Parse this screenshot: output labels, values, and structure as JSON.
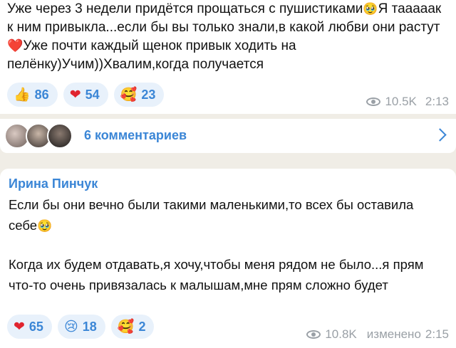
{
  "post": {
    "text_1": "Уже через 3 недели придётся прощаться с пушистиками",
    "emoji_1": "🥹",
    "text_2": "Я тааааак к ним привыкла...если бы вы только знали,в какой любви они растут",
    "emoji_2": "❤️",
    "text_3": "Уже почти каждый щенок привык ходить на пелёнку)Учим))Хвалим,когда получается",
    "reactions": [
      {
        "icon": "👍",
        "count": "86"
      },
      {
        "icon": "❤",
        "count": "54"
      },
      {
        "icon": "🥰",
        "count": "23"
      }
    ],
    "views": "10.5K",
    "time": "2:13"
  },
  "comments_bar": {
    "label": "6 комментариев"
  },
  "reply": {
    "author": "Ирина Пинчук",
    "text_1": "Если бы они вечно были такими маленькими,то всех бы оставила себе",
    "emoji_1": "🥹",
    "text_2": "Когда их будем отдавать,я хочу,чтобы меня рядом не было...я прям что-то очень привязалась к малышам,мне прям сложно будет",
    "reactions": [
      {
        "icon": "❤",
        "count": "65"
      },
      {
        "icon": "😢",
        "count": "18"
      },
      {
        "icon": "🥰",
        "count": "2"
      }
    ],
    "views": "10.8K",
    "edited": "изменено",
    "time": "2:15"
  },
  "colors": {
    "background": "#f0ede6",
    "bubble": "#ffffff",
    "accent": "#3b86d6",
    "reaction_bg": "#e8f1fb",
    "meta": "#9aa0a6"
  }
}
